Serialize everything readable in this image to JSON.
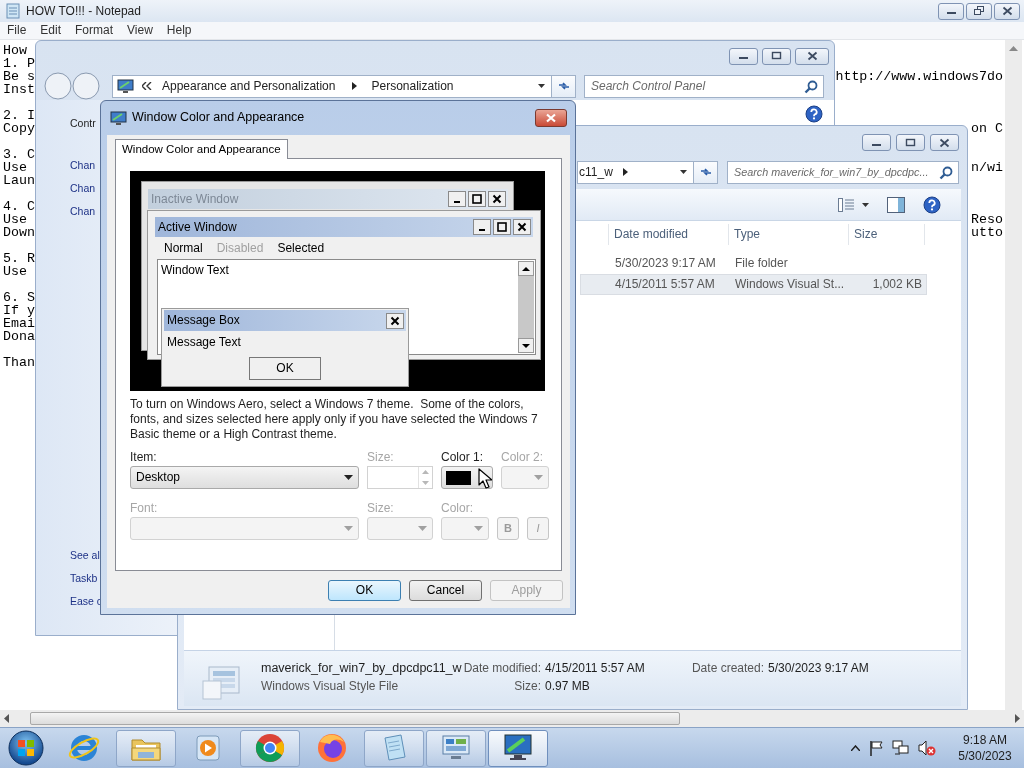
{
  "notepad": {
    "title": "HOW TO!!! - Notepad",
    "menu": [
      "File",
      "Edit",
      "Format",
      "View",
      "Help"
    ],
    "sections": [
      [
        {
          "start": "How"
        },
        {
          "start": "1. P"
        },
        {
          "start": "Be s",
          "end": "http://www.windows7do"
        },
        {
          "start": "Inst"
        }
      ],
      [
        {
          "start": "2. I"
        },
        {
          "start": "Copy",
          "end": "on C"
        }
      ],
      [
        {
          "start": "3. C"
        },
        {
          "start": "Use",
          "end": "n/wi"
        },
        {
          "start": "Laun"
        }
      ],
      [
        {
          "start": "4. C"
        },
        {
          "start": "Use",
          "end": "Reso"
        },
        {
          "start": "Down",
          "end": "utto"
        }
      ],
      [
        {
          "start": "5. R"
        },
        {
          "start": "Use"
        }
      ],
      [
        {
          "start": "6. S"
        },
        {
          "start": "If y"
        },
        {
          "start": "Emai"
        },
        {
          "start": "Dona"
        }
      ],
      [
        {
          "start": "Than"
        }
      ]
    ]
  },
  "control_panel": {
    "breadcrumb": [
      "Appearance and Personalization",
      "Personalization"
    ],
    "search": {
      "placeholder": "Search Control Panel"
    },
    "sidebar": {
      "top": [
        "Contr",
        "Chan",
        "Chan",
        "Chan"
      ],
      "bottom": [
        "See al",
        "Taskb",
        "Ease c"
      ]
    }
  },
  "explorer": {
    "address": "c11_w",
    "search": {
      "placeholder": "Search maverick_for_win7_by_dpcdpc..."
    },
    "columns": [
      "Date modified",
      "Type",
      "Size"
    ],
    "rows": [
      {
        "date_modified": "5/30/2023 9:17 AM",
        "type": "File folder",
        "selected": false
      },
      {
        "date_modified": "4/15/2011 5:57 AM",
        "type": "Windows Visual St...",
        "size": "1,002 KB",
        "selected": true
      }
    ],
    "details": {
      "name": "maverick_for_win7_by_dpcdpc11_w",
      "file_type": "Windows Visual Style File",
      "properties": [
        {
          "label": "Date modified:",
          "value": "4/15/2011 5:57 AM"
        },
        {
          "label": "Size:",
          "value": "0.97 MB"
        },
        {
          "label": "Date created:",
          "value": "5/30/2023 9:17 AM"
        }
      ]
    }
  },
  "dialog": {
    "title": "Window Color and Appearance",
    "tabs": [
      {
        "label": "Window Color and Appearance",
        "selected": true
      }
    ],
    "preview": {
      "inactive_title": "Inactive Window",
      "active_title": "Active Window",
      "menu": [
        {
          "label": "Normal",
          "disabled": false
        },
        {
          "label": "Disabled",
          "disabled": true
        },
        {
          "label": "Selected",
          "disabled": false
        }
      ],
      "window_text": "Window Text",
      "message_title": "Message Box",
      "message_text": "Message Text",
      "message_button": "OK"
    },
    "description": "To turn on Windows Aero, select a Windows 7 theme.  Some of the colors, fonts, and sizes selected here apply only if you have selected the Windows 7 Basic theme or a High Contrast theme.",
    "field_rows": [
      [
        {
          "kind": "select",
          "label": "Item:",
          "value": "Desktop",
          "disabled": false
        },
        {
          "kind": "spin",
          "label": "Size:",
          "disabled": true
        },
        {
          "kind": "color",
          "label": "Color 1:",
          "color": "#000000",
          "disabled": false
        },
        {
          "kind": "select",
          "label": "Color 2:",
          "disabled": true
        }
      ],
      [
        {
          "kind": "select",
          "label": "Font:",
          "disabled": true
        },
        {
          "kind": "select",
          "label": "Size:",
          "disabled": true
        },
        {
          "kind": "select",
          "label": "Color:",
          "disabled": true
        },
        {
          "kind": "toggle",
          "value": "B",
          "disabled": true
        },
        {
          "kind": "toggle",
          "value": "I",
          "disabled": true
        }
      ]
    ],
    "buttons": [
      {
        "label": "OK",
        "default": true,
        "disabled": false
      },
      {
        "label": "Cancel",
        "default": false,
        "disabled": false
      },
      {
        "label": "Apply",
        "default": false,
        "disabled": true
      }
    ]
  },
  "taskbar": {
    "items": [
      {
        "kind": "start"
      },
      {
        "kind": "internet-explorer",
        "running": false,
        "active": false
      },
      {
        "kind": "folder",
        "running": true,
        "active": false
      },
      {
        "kind": "media-player",
        "running": false,
        "active": false
      },
      {
        "kind": "chrome",
        "running": true,
        "active": false
      },
      {
        "kind": "firefox",
        "running": false,
        "active": false
      },
      {
        "kind": "notepad",
        "running": true,
        "active": false
      },
      {
        "kind": "control-panel",
        "running": true,
        "active": false
      },
      {
        "kind": "display",
        "running": true,
        "active": true
      }
    ],
    "clock": {
      "time": "9:18 AM",
      "date": "5/30/2023"
    }
  }
}
